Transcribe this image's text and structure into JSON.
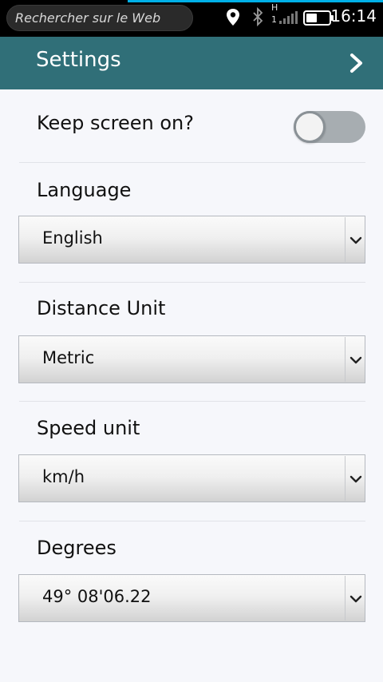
{
  "status_bar": {
    "search_text": "Rechercher sur le Web",
    "time": "16:14",
    "network": "H",
    "sim": "1"
  },
  "header": {
    "title": "Settings"
  },
  "settings": {
    "keep_screen_on": {
      "label": "Keep screen on?",
      "enabled": false
    },
    "language": {
      "label": "Language",
      "value": "English"
    },
    "distance_unit": {
      "label": "Distance Unit",
      "value": "Metric"
    },
    "speed_unit": {
      "label": "Speed unit",
      "value": "km/h"
    },
    "degrees": {
      "label": "Degrees",
      "value": "49° 08'06.22"
    }
  },
  "colors": {
    "header_bg": "#306f78",
    "page_bg": "#f6f7fb",
    "accent_line": "#00b0e8"
  },
  "icons": [
    "location-icon",
    "bluetooth-icon",
    "signal-icon",
    "battery-icon",
    "chevron-right-icon",
    "chevron-down-icon"
  ]
}
